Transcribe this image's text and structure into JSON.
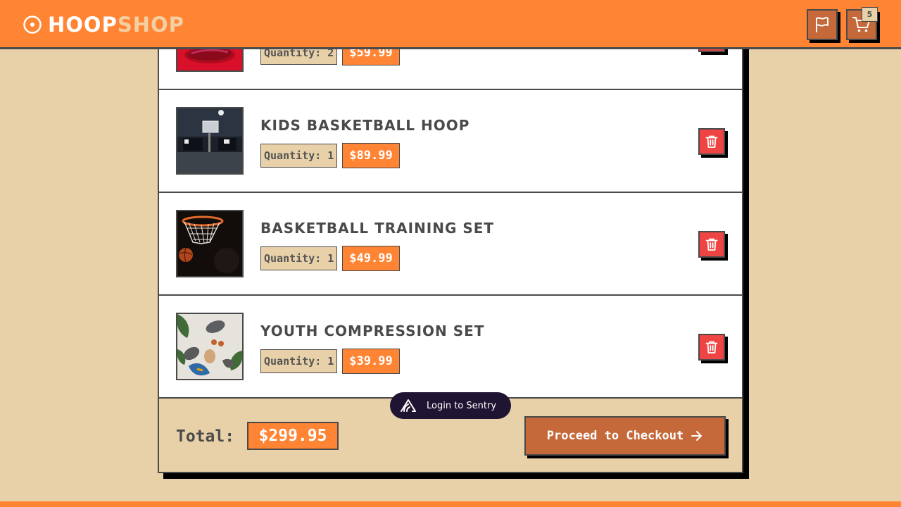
{
  "header": {
    "logo_part1": "HOOP",
    "logo_part2": "SHOP",
    "cart_count": "5"
  },
  "cart": {
    "items": [
      {
        "name": "",
        "quantity_label": "Quantity: 2",
        "price": "$59.99",
        "image": "red-sneaker"
      },
      {
        "name": "Kids Basketball Hoop",
        "quantity_label": "Quantity: 1",
        "price": "$89.99",
        "image": "indoor-court"
      },
      {
        "name": "Basketball Training Set",
        "quantity_label": "Quantity: 1",
        "price": "$49.99",
        "image": "ball-in-net"
      },
      {
        "name": "Youth Compression Set",
        "quantity_label": "Quantity: 1",
        "price": "$39.99",
        "image": "flatlay-outfit"
      }
    ],
    "total_label": "Total:",
    "total_value": "$299.95",
    "checkout_label": "Proceed to Checkout"
  },
  "sentry": {
    "label": "Login to Sentry"
  },
  "colors": {
    "accent": "#ff8434",
    "background": "#e8d0a8",
    "button_dark": "#c6693a",
    "danger": "#ee4444",
    "ink": "#4a4a4a",
    "sentry": "#1f1431"
  },
  "icons": {
    "logo": "target-circle-icon",
    "flag": "flag-icon",
    "cart": "cart-icon",
    "delete": "trash-icon",
    "checkout": "arrow-right-icon",
    "sentry": "sentry-logo-icon"
  }
}
